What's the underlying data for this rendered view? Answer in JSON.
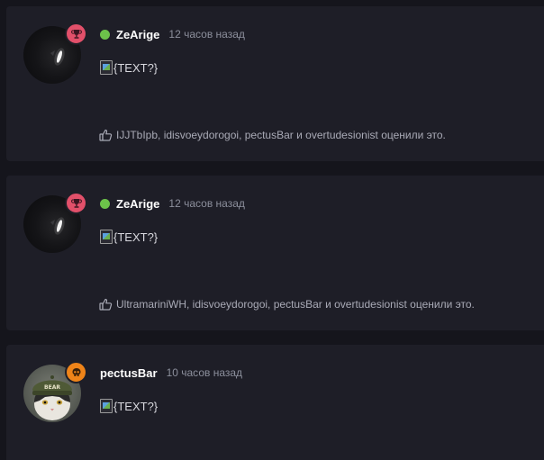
{
  "colors": {
    "page_background": "#15151c",
    "card_background": "#1e1e27",
    "online": "#6cc24a",
    "badge_trophy": "#e2506a",
    "badge_skull": "#ef8419",
    "username": "#ffffff",
    "timestamp": "#8c8f9c",
    "likes_text": "#a9aab6"
  },
  "posts": [
    {
      "author": "ZeArige",
      "online": true,
      "time": "12 часов назад",
      "badge_icon": "trophy-icon",
      "content_alt": "{TEXT?}",
      "likes": "IJJTbIpb, idisvoeydorogoi, pectusBar и overtudesionist оценили это."
    },
    {
      "author": "ZeArige",
      "online": true,
      "time": "12 часов назад",
      "badge_icon": "trophy-icon",
      "content_alt": "{TEXT?}",
      "likes": "UltramariniWH, idisvoeydorogoi, pectusBar и overtudesionist оценили это."
    },
    {
      "author": "pectusBar",
      "online": false,
      "time": "10 часов назад",
      "badge_icon": "skull-icon",
      "content_alt": "{TEXT?}",
      "avatar_cap_text": "BEAR"
    }
  ]
}
